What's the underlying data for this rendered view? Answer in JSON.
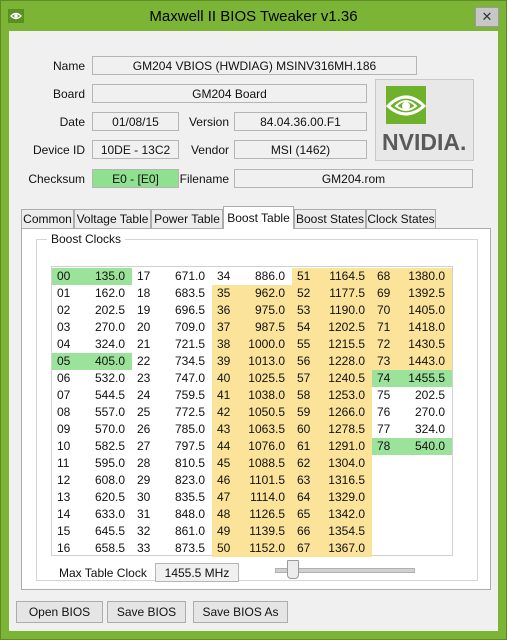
{
  "window": {
    "title": "Maxwell II BIOS Tweaker v1.36",
    "close_glyph": "✕"
  },
  "info": {
    "name_label": "Name",
    "name_value": "GM204 VBIOS (HWDIAG) MSINV316MH.186",
    "board_label": "Board",
    "board_value": "GM204 Board",
    "date_label": "Date",
    "date_value": "01/08/15",
    "version_label": "Version",
    "version_value": "84.04.36.00.F1",
    "device_label": "Device ID",
    "device_value": "10DE - 13C2",
    "vendor_label": "Vendor",
    "vendor_value": "MSI (1462)",
    "checksum_label": "Checksum",
    "checksum_value": "E0 - [E0]",
    "filename_label": "Filename",
    "filename_value": "GM204.rom"
  },
  "logo": {
    "text": "NVIDIA."
  },
  "tabs": [
    "Common",
    "Voltage Table",
    "Power Table",
    "Boost Table",
    "Boost States",
    "Clock States"
  ],
  "active_tab": "Boost Table",
  "group_title": "Boost Clocks",
  "boost_table": {
    "columns": [
      [
        [
          "00",
          "135.0"
        ],
        [
          "01",
          "162.0"
        ],
        [
          "02",
          "202.5"
        ],
        [
          "03",
          "270.0"
        ],
        [
          "04",
          "324.0"
        ],
        [
          "05",
          "405.0"
        ],
        [
          "06",
          "532.0"
        ],
        [
          "07",
          "544.5"
        ],
        [
          "08",
          "557.0"
        ],
        [
          "09",
          "570.0"
        ],
        [
          "10",
          "582.5"
        ],
        [
          "11",
          "595.0"
        ],
        [
          "12",
          "608.0"
        ],
        [
          "13",
          "620.5"
        ],
        [
          "14",
          "633.0"
        ],
        [
          "15",
          "645.5"
        ],
        [
          "16",
          "658.5"
        ]
      ],
      [
        [
          "17",
          "671.0"
        ],
        [
          "18",
          "683.5"
        ],
        [
          "19",
          "696.5"
        ],
        [
          "20",
          "709.0"
        ],
        [
          "21",
          "721.5"
        ],
        [
          "22",
          "734.5"
        ],
        [
          "23",
          "747.0"
        ],
        [
          "24",
          "759.5"
        ],
        [
          "25",
          "772.5"
        ],
        [
          "26",
          "785.0"
        ],
        [
          "27",
          "797.5"
        ],
        [
          "28",
          "810.5"
        ],
        [
          "29",
          "823.0"
        ],
        [
          "30",
          "835.5"
        ],
        [
          "31",
          "848.0"
        ],
        [
          "32",
          "861.0"
        ],
        [
          "33",
          "873.5"
        ]
      ],
      [
        [
          "34",
          "886.0"
        ],
        [
          "35",
          "962.0"
        ],
        [
          "36",
          "975.0"
        ],
        [
          "37",
          "987.5"
        ],
        [
          "38",
          "1000.0"
        ],
        [
          "39",
          "1013.0"
        ],
        [
          "40",
          "1025.5"
        ],
        [
          "41",
          "1038.0"
        ],
        [
          "42",
          "1050.5"
        ],
        [
          "43",
          "1063.5"
        ],
        [
          "44",
          "1076.0"
        ],
        [
          "45",
          "1088.5"
        ],
        [
          "46",
          "1101.5"
        ],
        [
          "47",
          "1114.0"
        ],
        [
          "48",
          "1126.5"
        ],
        [
          "49",
          "1139.5"
        ],
        [
          "50",
          "1152.0"
        ]
      ],
      [
        [
          "51",
          "1164.5"
        ],
        [
          "52",
          "1177.5"
        ],
        [
          "53",
          "1190.0"
        ],
        [
          "54",
          "1202.5"
        ],
        [
          "55",
          "1215.5"
        ],
        [
          "56",
          "1228.0"
        ],
        [
          "57",
          "1240.5"
        ],
        [
          "58",
          "1253.0"
        ],
        [
          "59",
          "1266.0"
        ],
        [
          "60",
          "1278.5"
        ],
        [
          "61",
          "1291.0"
        ],
        [
          "62",
          "1304.0"
        ],
        [
          "63",
          "1316.5"
        ],
        [
          "64",
          "1329.0"
        ],
        [
          "65",
          "1342.0"
        ],
        [
          "66",
          "1354.5"
        ],
        [
          "67",
          "1367.0"
        ]
      ],
      [
        [
          "68",
          "1380.0"
        ],
        [
          "69",
          "1392.5"
        ],
        [
          "70",
          "1405.0"
        ],
        [
          "71",
          "1418.0"
        ],
        [
          "72",
          "1430.5"
        ],
        [
          "73",
          "1443.0"
        ],
        [
          "74",
          "1455.5"
        ],
        [
          "75",
          "202.5"
        ],
        [
          "76",
          "270.0"
        ],
        [
          "77",
          "324.0"
        ],
        [
          "78",
          "540.0"
        ]
      ]
    ],
    "green_entries": [
      "00",
      "05",
      "74",
      "78"
    ],
    "yellow_entries": [
      "35",
      "36",
      "37",
      "38",
      "39",
      "40",
      "41",
      "42",
      "43",
      "44",
      "45",
      "46",
      "47",
      "48",
      "49",
      "50",
      "51",
      "52",
      "53",
      "54",
      "55",
      "56",
      "57",
      "58",
      "59",
      "60",
      "61",
      "62",
      "63",
      "64",
      "65",
      "66",
      "67",
      "68",
      "69",
      "70",
      "71",
      "72",
      "73"
    ],
    "colors": {
      "green": "#9be39b",
      "yellow": "#fbe39a",
      "window": "#7cb536"
    }
  },
  "max_clock": {
    "label": "Max Table Clock",
    "value": "1455.5 MHz"
  },
  "buttons": {
    "open": "Open BIOS",
    "save": "Save BIOS",
    "save_as": "Save BIOS As"
  }
}
